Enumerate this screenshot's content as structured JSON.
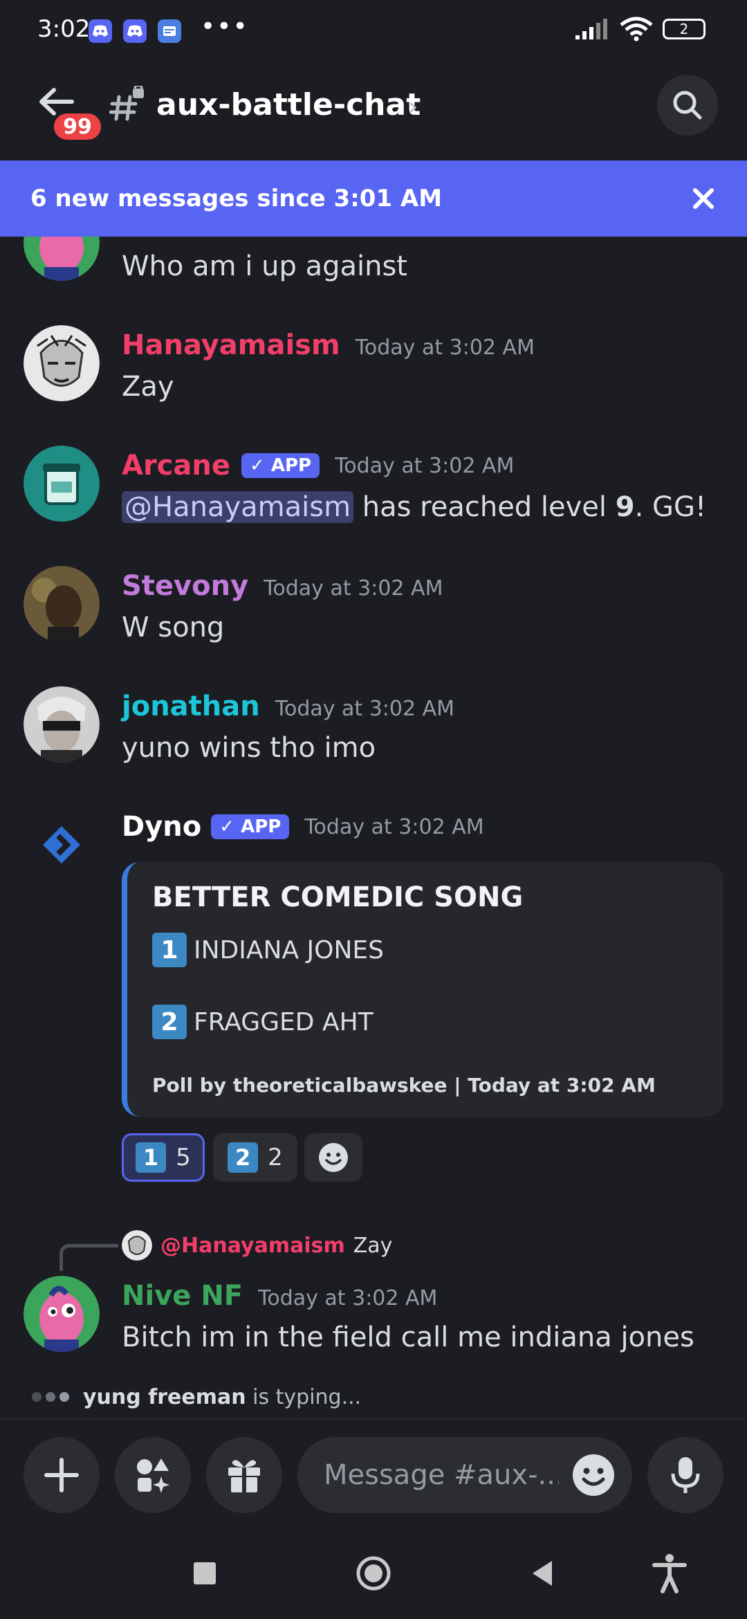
{
  "status_bar": {
    "time": "3:02",
    "battery": "2",
    "dots": "•••"
  },
  "header": {
    "back_badge": "99",
    "channel_name": "aux-battle-chat",
    "chevron": "›"
  },
  "banner": {
    "text": "6 new messages since 3:01 AM"
  },
  "messages": [
    {
      "author": "",
      "text": "Who am i up against"
    },
    {
      "author": "Hanayamaism",
      "timestamp": "Today at 3:02 AM",
      "text": "Zay",
      "color": "#f23f6a"
    },
    {
      "author": "Arcane",
      "app_tag": "✓ APP",
      "timestamp": "Today at 3:02 AM",
      "mention": "@Hanayamaism",
      "text_a": " has reached level ",
      "level": "9",
      "text_b": ". GG!",
      "color": "#f23f6a"
    },
    {
      "author": "Stevony",
      "timestamp": "Today at 3:02 AM",
      "text": "W song",
      "color": "#c27bdb"
    },
    {
      "author": "jonathan",
      "timestamp": "Today at 3:02 AM",
      "text": "yuno wins tho imo",
      "color": "#1cc6d8"
    },
    {
      "author": "Dyno",
      "app_tag": "✓ APP",
      "timestamp": "Today at 3:02 AM",
      "color": "#ffffff"
    }
  ],
  "poll": {
    "title": "BETTER COMEDIC SONG",
    "options": [
      {
        "key": "1",
        "label": "INDIANA JONES"
      },
      {
        "key": "2",
        "label": "FRAGGED AHT"
      }
    ],
    "footer": "Poll by theoreticalbawskee | Today at 3:02 AM",
    "reactions": [
      {
        "key": "1",
        "count": "5",
        "active": true
      },
      {
        "key": "2",
        "count": "2",
        "active": false
      }
    ]
  },
  "reply": {
    "reply_to_mention": "@Hanayamaism",
    "reply_to_text": "Zay",
    "author": "Nive NF",
    "timestamp": "Today at 3:02 AM",
    "text": "Bitch im in the field call me indiana jones",
    "color": "#3ba55c"
  },
  "typing": {
    "user": "yung freeman",
    "suffix": " is typing..."
  },
  "composer": {
    "placeholder": "Message #aux-..."
  },
  "colors": {
    "accent": "#5865f2",
    "background": "#1c1d22",
    "badge": "#ed4245"
  }
}
